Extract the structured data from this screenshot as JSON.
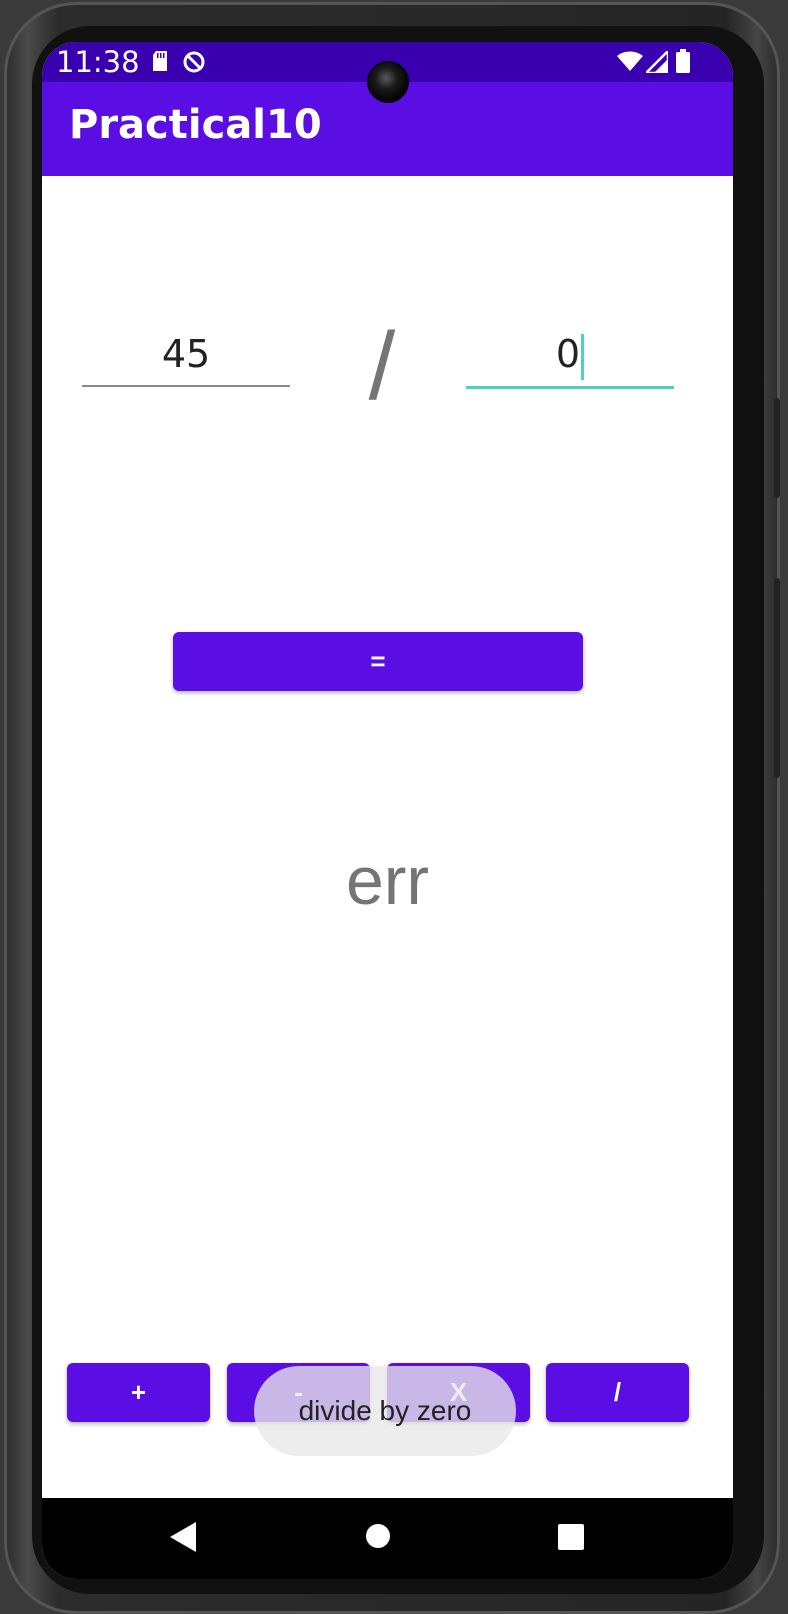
{
  "status_bar": {
    "time": "11:38",
    "left_icons": [
      "sd-card-icon",
      "sync-disabled-icon"
    ],
    "right_icons": [
      "wifi-icon",
      "signal-icon",
      "battery-icon"
    ],
    "background": "#3a00b0"
  },
  "app_bar": {
    "title": "Practical10",
    "background": "#5b0ee3"
  },
  "calculator": {
    "first_operand": "45",
    "operator_symbol": "/",
    "second_operand": "0",
    "equals_label": "=",
    "result": "err"
  },
  "operation_buttons": [
    {
      "label": "+"
    },
    {
      "label": "-"
    },
    {
      "label": "X"
    },
    {
      "label": "/"
    }
  ],
  "toast": {
    "message": "divide by zero"
  },
  "nav_bar": {
    "buttons": [
      "back-icon",
      "home-icon",
      "recents-icon"
    ]
  },
  "colors": {
    "accent": "#5b0ee3",
    "focus_underline": "#4fd1c0",
    "muted_text": "#757575"
  }
}
